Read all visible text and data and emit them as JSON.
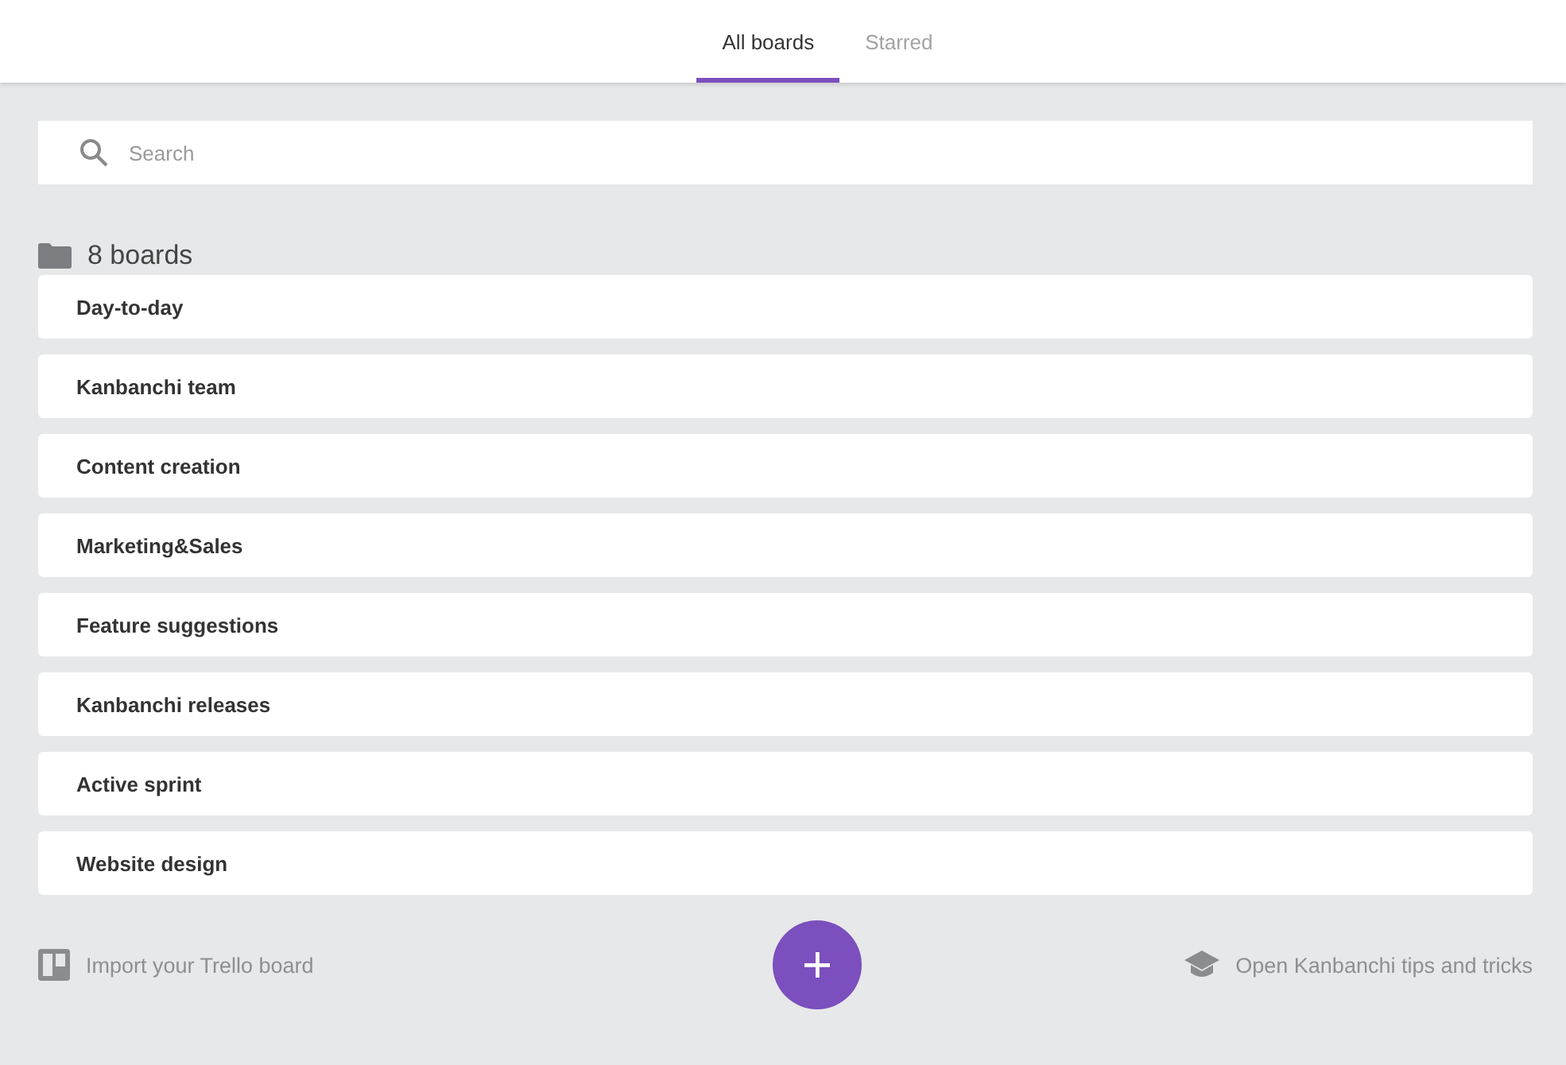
{
  "tabs": [
    {
      "label": "All boards",
      "selected": true
    },
    {
      "label": "Starred",
      "selected": false
    }
  ],
  "search": {
    "placeholder": "Search"
  },
  "boards_count": "8 boards",
  "boards": [
    {
      "name": "Day-to-day"
    },
    {
      "name": "Kanbanchi team"
    },
    {
      "name": "Content creation"
    },
    {
      "name": "Marketing&Sales"
    },
    {
      "name": "Feature suggestions"
    },
    {
      "name": "Kanbanchi releases"
    },
    {
      "name": "Active sprint"
    },
    {
      "name": "Website design"
    }
  ],
  "footer": {
    "import_link": "Import your Trello board",
    "tips_link": "Open Kanbanchi tips and tricks"
  }
}
